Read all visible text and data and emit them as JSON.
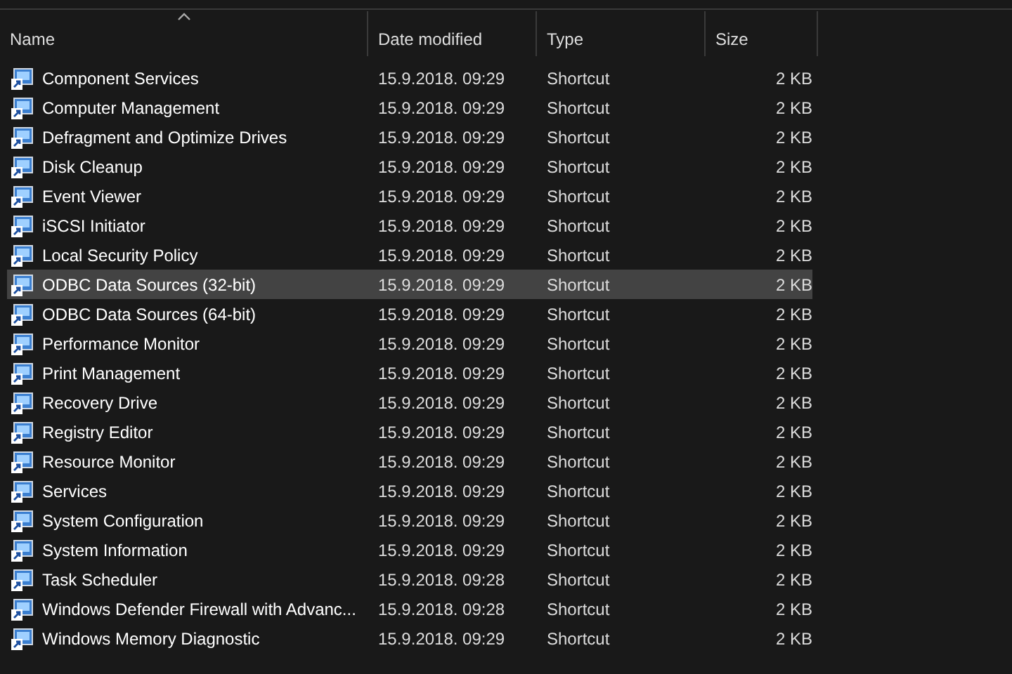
{
  "table": {
    "columns": [
      {
        "label": "Name",
        "sorted": true
      },
      {
        "label": "Date modified",
        "sorted": false
      },
      {
        "label": "Type",
        "sorted": false
      },
      {
        "label": "Size",
        "sorted": false
      }
    ],
    "rows": [
      {
        "name": "Component Services",
        "date": "15.9.2018. 09:29",
        "type": "Shortcut",
        "size": "2 KB",
        "selected": false
      },
      {
        "name": "Computer Management",
        "date": "15.9.2018. 09:29",
        "type": "Shortcut",
        "size": "2 KB",
        "selected": false
      },
      {
        "name": "Defragment and Optimize Drives",
        "date": "15.9.2018. 09:29",
        "type": "Shortcut",
        "size": "2 KB",
        "selected": false
      },
      {
        "name": "Disk Cleanup",
        "date": "15.9.2018. 09:29",
        "type": "Shortcut",
        "size": "2 KB",
        "selected": false
      },
      {
        "name": "Event Viewer",
        "date": "15.9.2018. 09:29",
        "type": "Shortcut",
        "size": "2 KB",
        "selected": false
      },
      {
        "name": "iSCSI Initiator",
        "date": "15.9.2018. 09:29",
        "type": "Shortcut",
        "size": "2 KB",
        "selected": false
      },
      {
        "name": "Local Security Policy",
        "date": "15.9.2018. 09:29",
        "type": "Shortcut",
        "size": "2 KB",
        "selected": false
      },
      {
        "name": "ODBC Data Sources (32-bit)",
        "date": "15.9.2018. 09:29",
        "type": "Shortcut",
        "size": "2 KB",
        "selected": true
      },
      {
        "name": "ODBC Data Sources (64-bit)",
        "date": "15.9.2018. 09:29",
        "type": "Shortcut",
        "size": "2 KB",
        "selected": false
      },
      {
        "name": "Performance Monitor",
        "date": "15.9.2018. 09:29",
        "type": "Shortcut",
        "size": "2 KB",
        "selected": false
      },
      {
        "name": "Print Management",
        "date": "15.9.2018. 09:29",
        "type": "Shortcut",
        "size": "2 KB",
        "selected": false
      },
      {
        "name": "Recovery Drive",
        "date": "15.9.2018. 09:29",
        "type": "Shortcut",
        "size": "2 KB",
        "selected": false
      },
      {
        "name": "Registry Editor",
        "date": "15.9.2018. 09:29",
        "type": "Shortcut",
        "size": "2 KB",
        "selected": false
      },
      {
        "name": "Resource Monitor",
        "date": "15.9.2018. 09:29",
        "type": "Shortcut",
        "size": "2 KB",
        "selected": false
      },
      {
        "name": "Services",
        "date": "15.9.2018. 09:29",
        "type": "Shortcut",
        "size": "2 KB",
        "selected": false
      },
      {
        "name": "System Configuration",
        "date": "15.9.2018. 09:29",
        "type": "Shortcut",
        "size": "2 KB",
        "selected": false
      },
      {
        "name": "System Information",
        "date": "15.9.2018. 09:29",
        "type": "Shortcut",
        "size": "2 KB",
        "selected": false
      },
      {
        "name": "Task Scheduler",
        "date": "15.9.2018. 09:28",
        "type": "Shortcut",
        "size": "2 KB",
        "selected": false
      },
      {
        "name": "Windows Defender Firewall with Advanc...",
        "date": "15.9.2018. 09:28",
        "type": "Shortcut",
        "size": "2 KB",
        "selected": false
      },
      {
        "name": "Windows Memory Diagnostic",
        "date": "15.9.2018. 09:29",
        "type": "Shortcut",
        "size": "2 KB",
        "selected": false
      }
    ]
  }
}
